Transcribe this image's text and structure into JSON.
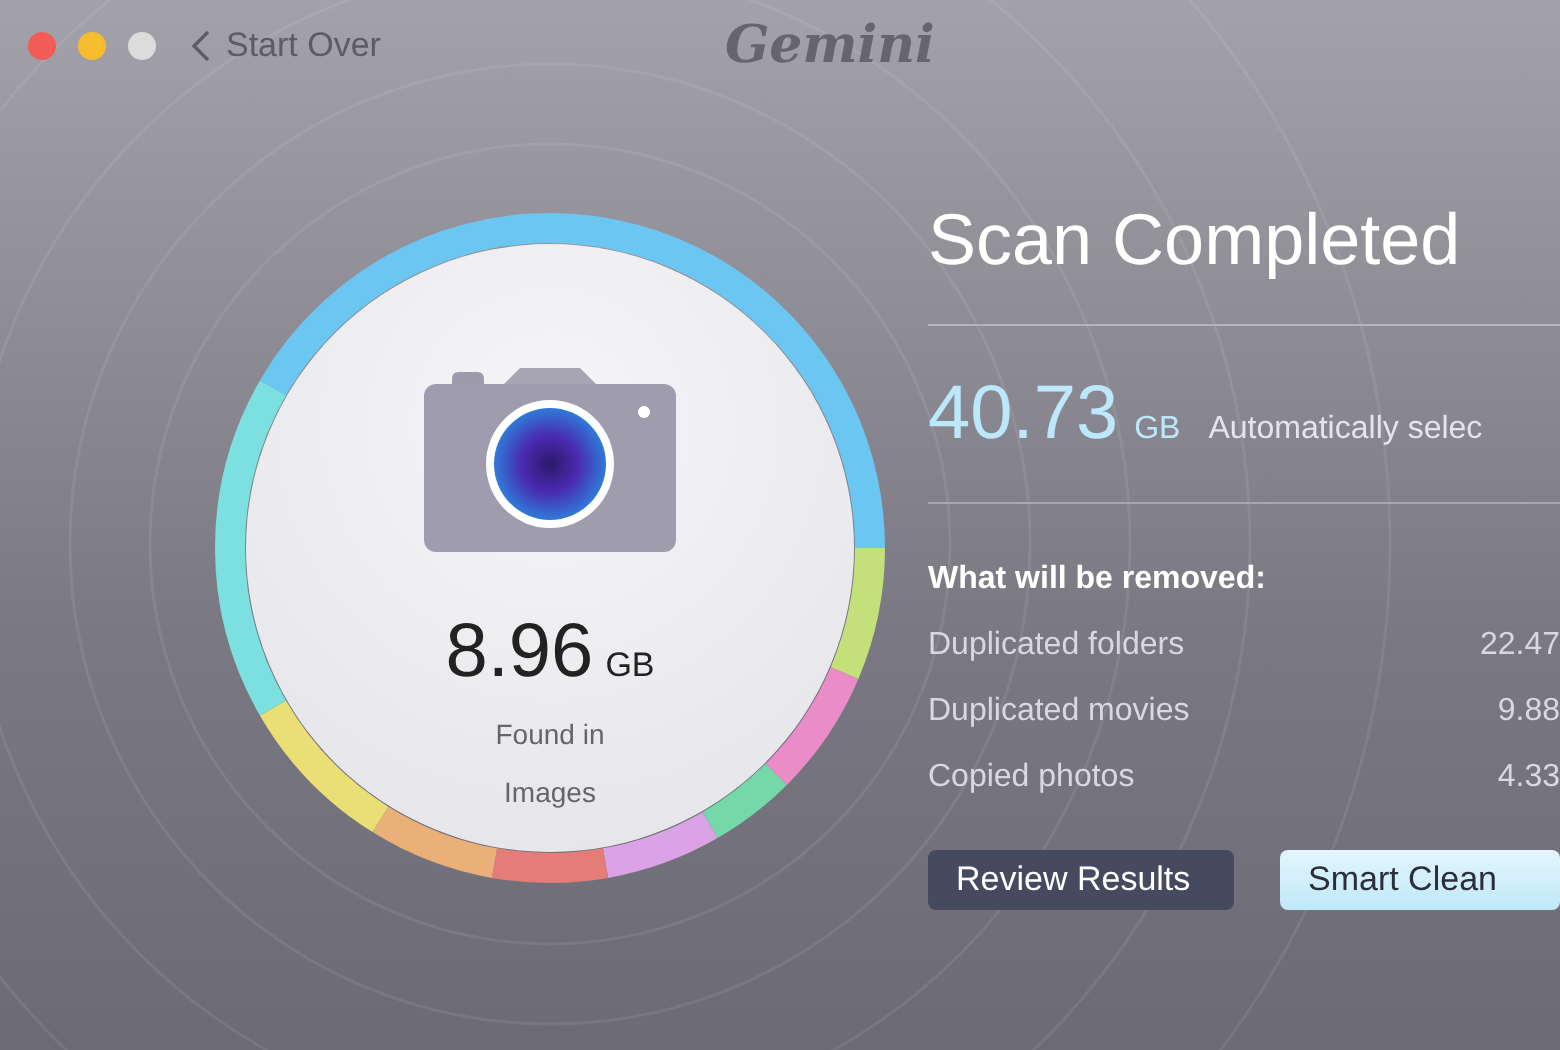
{
  "window": {
    "title": "Gemini",
    "back_label": "Start Over"
  },
  "summary": {
    "size": "8.96",
    "unit": "GB",
    "caption": "Found in",
    "category": "Images"
  },
  "status": {
    "title": "Scan Completed",
    "total": "40.73",
    "total_unit": "GB",
    "note": "Automatically selec"
  },
  "removal": {
    "heading": "What will be removed:",
    "items": [
      {
        "label": "Duplicated folders",
        "value": "22.47"
      },
      {
        "label": "Duplicated movies",
        "value": "9.88"
      },
      {
        "label": "Copied photos",
        "value": "4.33"
      }
    ]
  },
  "buttons": [
    {
      "label": "Review Results",
      "kind": "secondary"
    },
    {
      "label": "Smart Clean",
      "kind": "primary"
    }
  ]
}
